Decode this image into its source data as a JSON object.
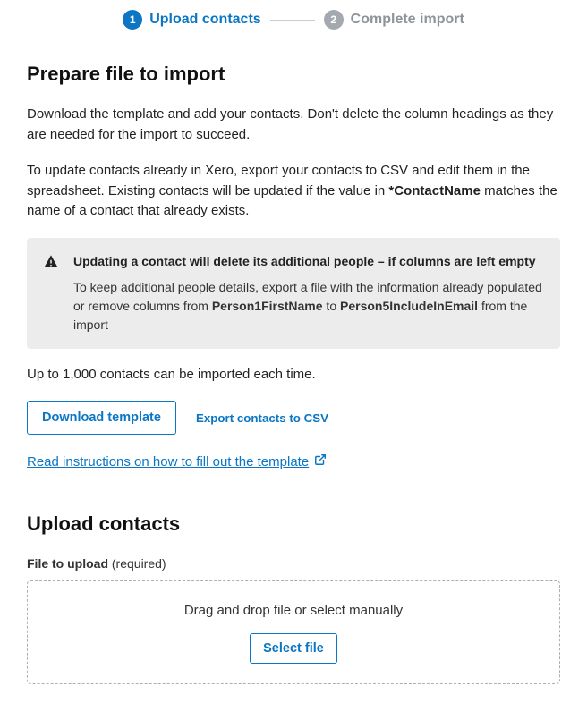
{
  "stepper": {
    "step1_num": "1",
    "step1_label": "Upload contacts",
    "step2_num": "2",
    "step2_label": "Complete import"
  },
  "prepare": {
    "title": "Prepare file to import",
    "p1": "Download the template and add your contacts. Don't delete the column headings as they are needed for the import to succeed.",
    "p2_pre": "To update contacts already in Xero, export your contacts to CSV and edit them in the spreadsheet. Existing contacts will be updated if the value in ",
    "p2_bold": "*ContactName",
    "p2_post": " matches the name of a contact that already exists."
  },
  "warning": {
    "title": "Updating a contact will delete its additional people – if columns are left empty",
    "body_pre": "To keep additional people details, export a file with the information already populated or remove columns from ",
    "body_b1": "Person1FirstName",
    "body_mid": " to ",
    "body_b2": "Person5IncludeInEmail",
    "body_post": " from the import"
  },
  "limit_text": "Up to 1,000 contacts can be imported each time.",
  "buttons": {
    "download_template": "Download template",
    "export_csv": "Export contacts to CSV",
    "instructions_link": "Read instructions on how to fill out the template"
  },
  "upload": {
    "title": "Upload contacts",
    "label": "File to upload",
    "required": "(required)",
    "dropzone_text": "Drag and drop file or select manually",
    "select_file": "Select file"
  }
}
